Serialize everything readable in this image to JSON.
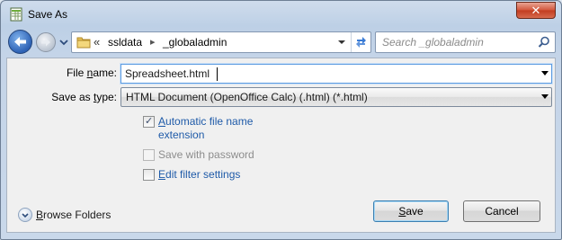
{
  "window": {
    "title": "Save As",
    "close_label": "✕"
  },
  "nav": {
    "breadcrumb_prefix": "«",
    "crumbs": [
      "ssldata",
      "_globaladmin"
    ],
    "crumb_separator": "▸"
  },
  "search": {
    "placeholder": "Search _globaladmin"
  },
  "form": {
    "filename_label_pre": "File ",
    "filename_label_u": "n",
    "filename_label_post": "ame:",
    "filename_value": "Spreadsheet.html",
    "savetype_label_pre": "Save as ",
    "savetype_label_u": "t",
    "savetype_label_post": "ype:",
    "savetype_value": "HTML Document (OpenOffice Calc) (.html) (*.html)"
  },
  "options": {
    "auto_ext_u": "A",
    "auto_ext_line1_rest": "utomatic file name",
    "auto_ext_line2": "extension",
    "auto_ext_checked": true,
    "password_label": "Save with password",
    "password_checked": false,
    "filter_u": "E",
    "filter_rest": "dit filter settings",
    "filter_checked": false
  },
  "footer": {
    "browse_u": "B",
    "browse_rest": "rowse Folders",
    "save_u": "S",
    "save_rest": "ave",
    "cancel_label": "Cancel"
  },
  "icons": {
    "app": "spreadsheet-icon",
    "back": "back-arrow-icon",
    "forward": "forward-arrow-icon",
    "folder": "folder-icon",
    "refresh": "refresh-icon",
    "search": "search-icon",
    "browse": "chevron-down-circle-icon"
  },
  "colors": {
    "link": "#1e5aa8",
    "accent": "#3c7fb1",
    "close": "#c23b1f"
  }
}
